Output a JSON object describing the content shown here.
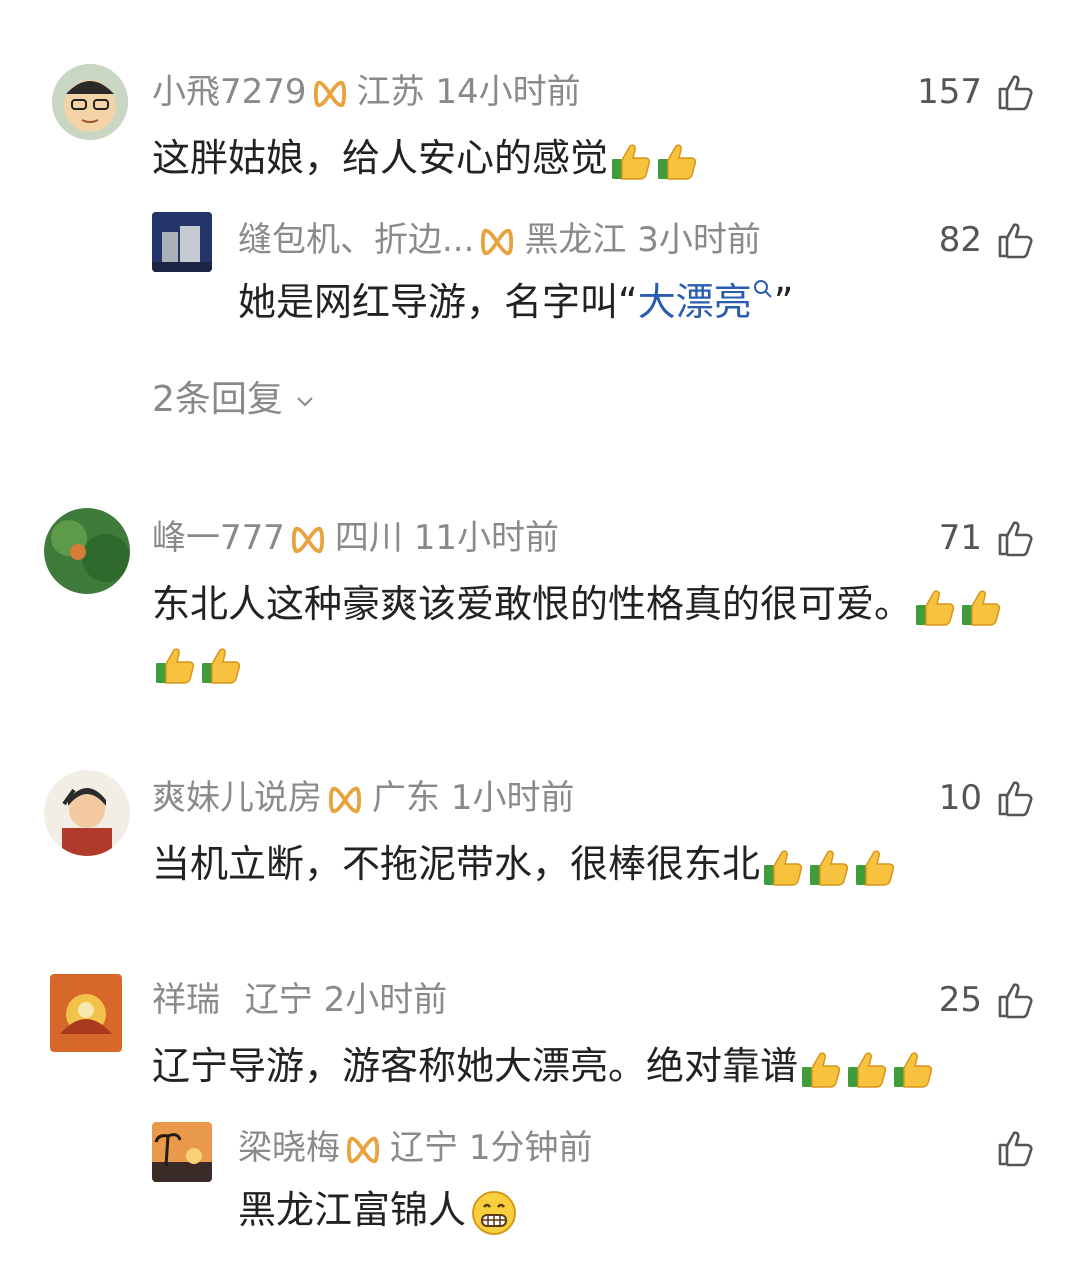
{
  "comments": [
    {
      "name": "小飛7279",
      "location": "江苏",
      "time": "14小时前",
      "likes": "157",
      "text": "这胖姑娘，给人安心的感觉",
      "thumbs": 2,
      "replies": [
        {
          "name": "缝包机、折边...",
          "location": "黑龙江",
          "time": "3小时前",
          "likes": "82",
          "text_prefix": "她是网红导游，名字叫“",
          "link": "大漂亮",
          "text_suffix": "”"
        }
      ],
      "more_replies": "2条回复"
    },
    {
      "name": "峰一777",
      "location": "四川",
      "time": "11小时前",
      "likes": "71",
      "text": "东北人这种豪爽该爱敢恨的性格真的很可爱。"
    },
    {
      "name": "爽妹儿说房",
      "location": "广东",
      "time": "1小时前",
      "likes": "10",
      "text": "当机立断，不拖泥带水，很棒很东北"
    },
    {
      "name": "祥瑞",
      "location": "辽宁",
      "time": "2小时前",
      "likes": "25",
      "text": "辽宁导游，游客称她大漂亮。绝对靠谱",
      "replies": [
        {
          "name": "梁晓梅",
          "location": "辽宁",
          "time": "1分钟前",
          "likes": "",
          "text": "黑龙江富锦人"
        }
      ]
    }
  ],
  "colors": {
    "meta": "#8a8a8a",
    "text": "#222222",
    "link": "#2a5db0",
    "badge": "#e8a33d"
  },
  "icons": {
    "like": "thumbs-up-outline-icon",
    "emoji": "thumbs-up-emoji-icon",
    "grin": "grin-emoji-icon",
    "badge": "gold-badge-icon",
    "search": "search-icon"
  }
}
